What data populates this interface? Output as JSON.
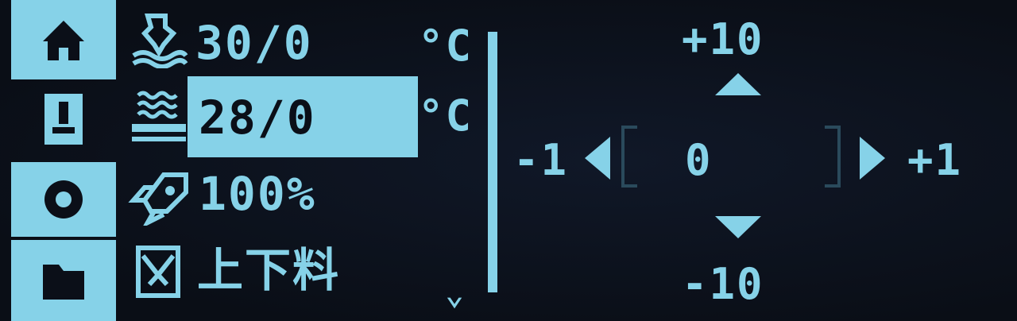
{
  "tabs": [
    {
      "icon": "home-icon",
      "selected": true
    },
    {
      "icon": "printer-icon",
      "selected": false
    },
    {
      "icon": "settings-icon",
      "selected": true
    },
    {
      "icon": "folder-icon",
      "selected": true
    }
  ],
  "rows": {
    "nozzle_temp": "30/0",
    "bed_temp": "28/0",
    "temp_unit": "°C",
    "fan_speed": "100%",
    "filament_label": "上下料",
    "more_indicator": "⌄"
  },
  "move": {
    "up_label": "+10",
    "down_label": "-10",
    "left_label": "-1",
    "right_label": "+1",
    "value": "0"
  },
  "colors": {
    "foreground": "#86d2e8",
    "background": "#0b0f18"
  }
}
